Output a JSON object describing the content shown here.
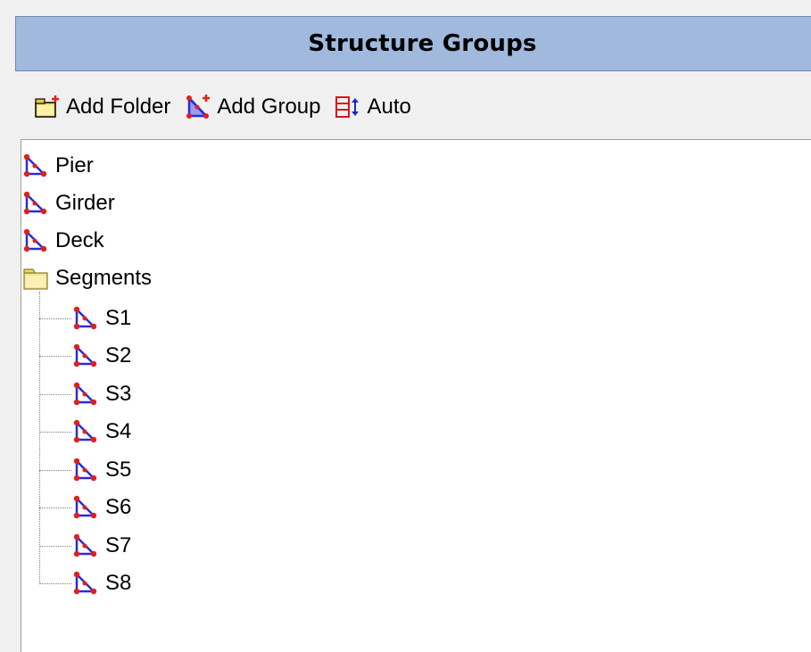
{
  "panel": {
    "title": "Structure Groups"
  },
  "toolbar": {
    "add_folder_label": "Add Folder",
    "add_group_label": "Add Group",
    "auto_label": "Auto"
  },
  "tree": {
    "top_items": [
      {
        "label": "Pier",
        "icon": "structure-group-icon"
      },
      {
        "label": "Girder",
        "icon": "structure-group-icon"
      },
      {
        "label": "Deck",
        "icon": "structure-group-icon"
      }
    ],
    "folder": {
      "label": "Segments",
      "icon": "folder-icon",
      "children": [
        {
          "label": "S1",
          "icon": "structure-group-icon"
        },
        {
          "label": "S2",
          "icon": "structure-group-icon"
        },
        {
          "label": "S3",
          "icon": "structure-group-icon"
        },
        {
          "label": "S4",
          "icon": "structure-group-icon"
        },
        {
          "label": "S5",
          "icon": "structure-group-icon"
        },
        {
          "label": "S6",
          "icon": "structure-group-icon"
        },
        {
          "label": "S7",
          "icon": "structure-group-icon"
        },
        {
          "label": "S8",
          "icon": "structure-group-icon"
        }
      ]
    }
  },
  "colors": {
    "title_bar": "#a0b9dd",
    "group_icon_stroke": "#2a2adf",
    "group_icon_node": "#e0201a",
    "folder_fill": "#f6e58a"
  }
}
